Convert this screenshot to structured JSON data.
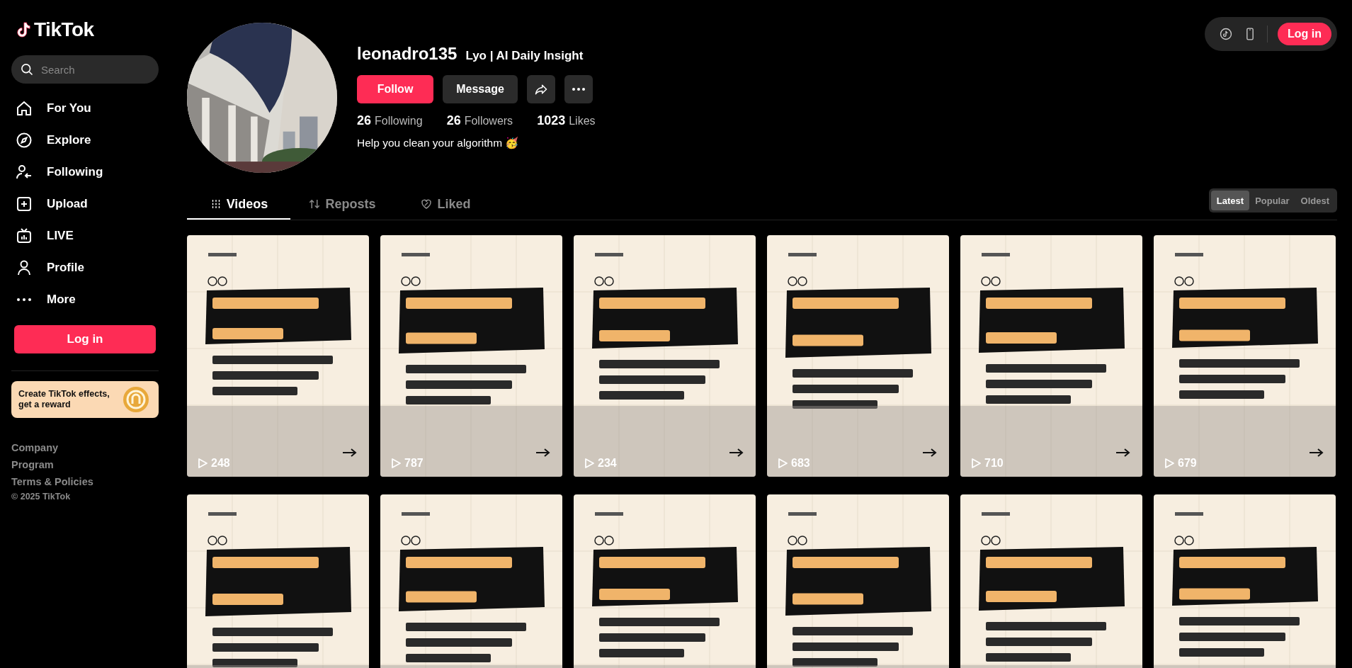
{
  "sidebar": {
    "logo": "TikTok",
    "search": {
      "placeholder": "Search"
    },
    "nav": [
      {
        "kind": "home",
        "label": "For You"
      },
      {
        "kind": "explore",
        "label": "Explore"
      },
      {
        "kind": "following",
        "label": "Following"
      },
      {
        "kind": "upload",
        "label": "Upload"
      },
      {
        "kind": "live",
        "label": "LIVE"
      },
      {
        "kind": "profile",
        "label": "Profile"
      },
      {
        "kind": "more",
        "label": "More"
      }
    ],
    "login": "Log in",
    "promo": "Create TikTok effects, get a reward",
    "footer_links": [
      "Company",
      "Program",
      "Terms & Policies"
    ],
    "copyright": "© 2025 TikTok"
  },
  "top_bar": {
    "login": "Log in"
  },
  "profile": {
    "username": "leonadro135",
    "nickname": "Lyo | AI Daily Insight",
    "follow": "Follow",
    "message": "Message",
    "stats": [
      {
        "value": "26",
        "label": "Following"
      },
      {
        "value": "26",
        "label": "Followers"
      },
      {
        "value": "1023",
        "label": "Likes"
      }
    ],
    "bio": "Help you clean your algorithm 🥳"
  },
  "tabs": [
    {
      "kind": "videos",
      "label": "Videos",
      "selected": true
    },
    {
      "kind": "reposts",
      "label": "Reposts",
      "selected": false
    },
    {
      "kind": "liked",
      "label": "Liked",
      "selected": false
    }
  ],
  "sort": [
    {
      "label": "Latest",
      "selected": true
    },
    {
      "label": "Popular",
      "selected": false
    },
    {
      "label": "Oldest",
      "selected": false
    }
  ],
  "videos": [
    {
      "kind": "picture",
      "views": "248"
    },
    {
      "kind": "picture",
      "views": "787"
    },
    {
      "kind": "picture",
      "views": "234"
    },
    {
      "kind": "picture",
      "views": "683"
    },
    {
      "kind": "picture",
      "views": "710"
    },
    {
      "kind": "picture",
      "views": "679"
    },
    {
      "kind": "picture"
    },
    {
      "kind": "picture"
    },
    {
      "kind": "picture"
    },
    {
      "kind": "picture"
    },
    {
      "kind": "picture"
    },
    {
      "kind": "picture"
    }
  ]
}
